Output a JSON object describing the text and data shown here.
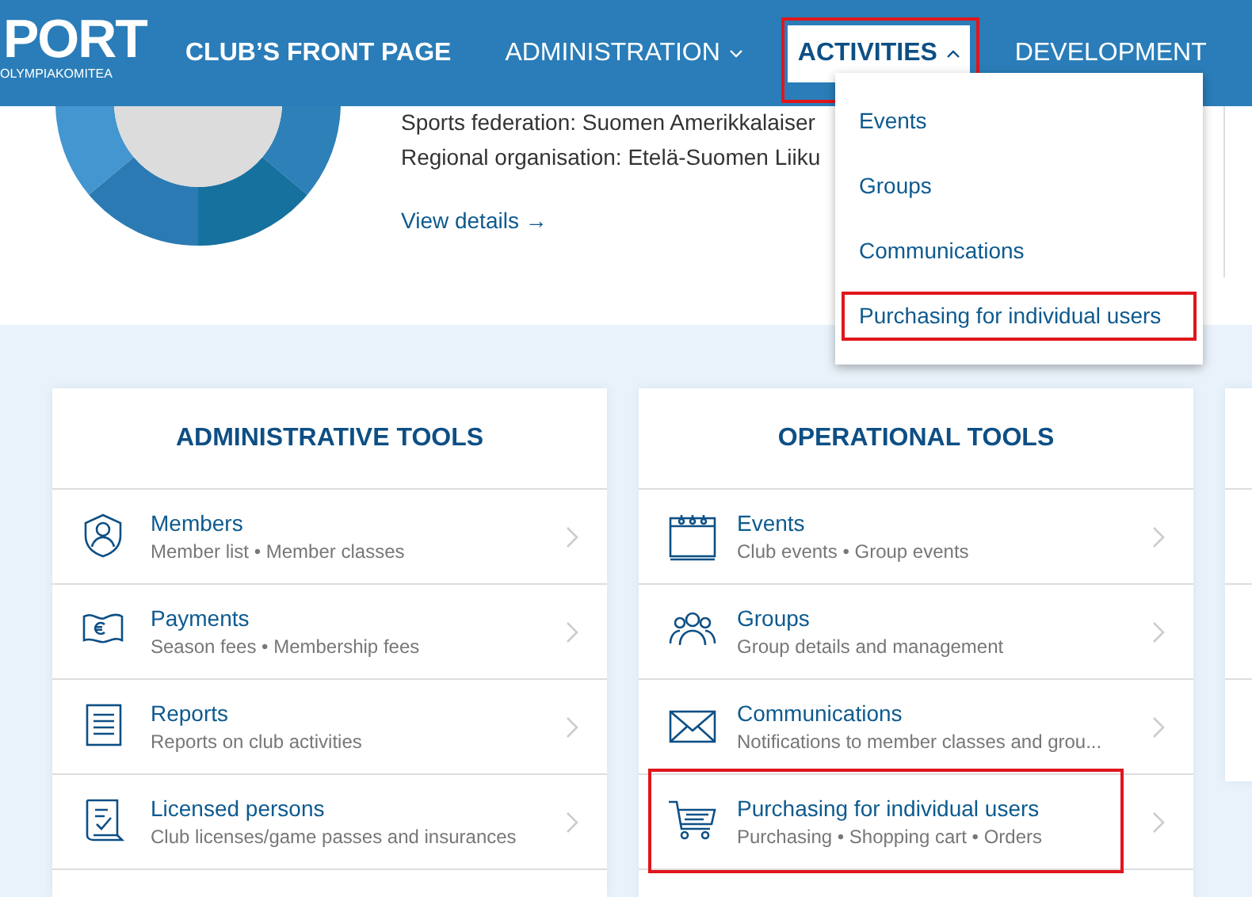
{
  "header": {
    "logo": {
      "wordmark": "PORT",
      "tagline": "OLYMPIAKOMITEA"
    },
    "nav": [
      {
        "label": "CLUB’S FRONT PAGE",
        "kind": "link",
        "selected": false,
        "highlighted": false
      },
      {
        "label": "ADMINISTRATION",
        "kind": "dropdown",
        "selected": false,
        "expanded": false,
        "highlighted": false
      },
      {
        "label": "ACTIVITIES",
        "kind": "dropdown",
        "selected": true,
        "expanded": true,
        "highlighted": true
      },
      {
        "label": "DEVELOPMENT",
        "kind": "link",
        "selected": false,
        "highlighted": false
      }
    ],
    "dropdown": [
      {
        "label": "Events",
        "highlighted": false
      },
      {
        "label": "Groups",
        "highlighted": false
      },
      {
        "label": "Communications",
        "highlighted": false
      },
      {
        "label": "Purchasing for individual users",
        "highlighted": true
      }
    ]
  },
  "club": {
    "lines": [
      "Sports federation: Suomen Amerikkalaiser",
      "Regional organisation: Etelä-Suomen Liiku"
    ],
    "link": "View details →"
  },
  "cards": [
    {
      "title": "ADMINISTRATIVE TOOLS",
      "items": [
        {
          "title": "Members",
          "subtitle": "Member list • Member classes",
          "highlighted": false
        },
        {
          "title": "Payments",
          "subtitle": "Season fees • Membership fees",
          "highlighted": false
        },
        {
          "title": "Reports",
          "subtitle": "Reports on club activities",
          "highlighted": false
        },
        {
          "title": "Licensed persons",
          "subtitle": "Club licenses/game passes and insurances",
          "highlighted": false
        }
      ]
    },
    {
      "title": "OPERATIONAL TOOLS",
      "items": [
        {
          "title": "Events",
          "subtitle": "Club events • Group events",
          "highlighted": false
        },
        {
          "title": "Groups",
          "subtitle": "Group details and management",
          "highlighted": false
        },
        {
          "title": "Communications",
          "subtitle": "Notifications to member classes and grou...",
          "highlighted": false
        },
        {
          "title": "Purchasing for individual users",
          "subtitle": "Purchasing • Shopping cart • Orders",
          "highlighted": true
        }
      ]
    }
  ]
}
